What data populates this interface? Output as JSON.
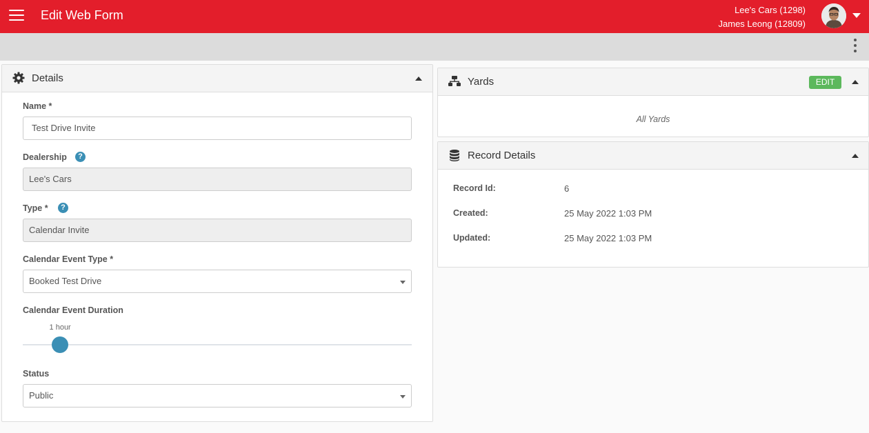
{
  "header": {
    "title": "Edit Web Form",
    "dealer": "Lee's Cars (1298)",
    "user": "James Leong (12809)"
  },
  "colors": {
    "brand": "#e31e2b",
    "accent": "#3b8fb5",
    "edit_badge": "#5cb85c"
  },
  "details": {
    "title": "Details",
    "name": {
      "label": "Name *",
      "value": "Test Drive Invite"
    },
    "dealership": {
      "label": "Dealership",
      "value": "Lee's Cars"
    },
    "type": {
      "label": "Type *",
      "value": "Calendar Invite"
    },
    "event_type": {
      "label": "Calendar Event Type *",
      "value": "Booked Test Drive"
    },
    "duration": {
      "label": "Calendar Event Duration",
      "value_label": "1 hour",
      "slider_fraction": 0.096
    },
    "status": {
      "label": "Status",
      "value": "Public"
    }
  },
  "yards": {
    "title": "Yards",
    "edit_label": "EDIT",
    "summary": "All Yards"
  },
  "record": {
    "title": "Record Details",
    "rows": [
      {
        "label": "Record Id:",
        "value": "6"
      },
      {
        "label": "Created:",
        "value": "25 May 2022 1:03 PM"
      },
      {
        "label": "Updated:",
        "value": "25 May 2022 1:03 PM"
      }
    ]
  }
}
